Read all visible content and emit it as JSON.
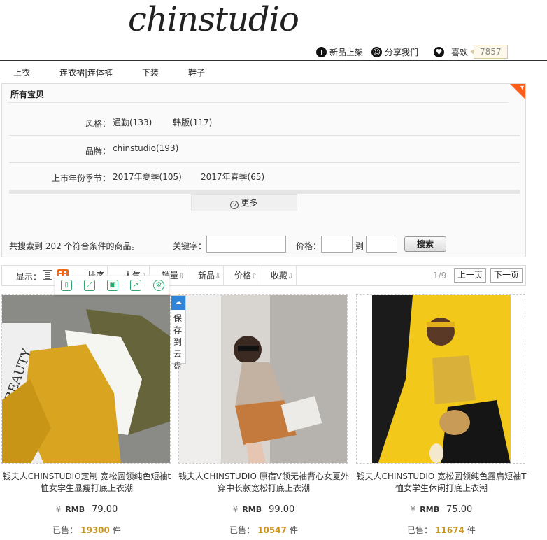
{
  "header": {
    "logo": "chinstudio",
    "links": [
      {
        "icon": "plus-circle-icon",
        "label": "新品上架"
      },
      {
        "icon": "share-circle-icon",
        "label": "分享我们"
      },
      {
        "icon": "heart-circle-icon",
        "label": "喜欢"
      }
    ],
    "like_count": "7857"
  },
  "nav": [
    "上衣",
    "连衣裙|连体裤",
    "下装",
    "鞋子"
  ],
  "filter": {
    "title": "所有宝贝",
    "rows": [
      {
        "label": "风格：",
        "options": [
          "通勤(133)",
          "韩版(117)"
        ]
      },
      {
        "label": "品牌：",
        "options": [
          "chinstudio(193)"
        ]
      },
      {
        "label": "上市年份季节：",
        "options": [
          "2017年夏季(105)",
          "2017年春季(65)"
        ]
      }
    ],
    "more_label": "更多",
    "result_text": "共搜索到 202 个符合条件的商品。",
    "keyword_label": "关键字：",
    "keyword_value": "",
    "price_label": "价格：",
    "price_to": "到",
    "price_min": "",
    "price_max": "",
    "search_button": "搜索"
  },
  "sortbar": {
    "display_label": "显示：",
    "items": [
      {
        "label": "排序",
        "arrow": ""
      },
      {
        "label": "人气",
        "arrow": "⇩"
      },
      {
        "label": "销量",
        "arrow": "⇩"
      },
      {
        "label": "新品",
        "arrow": "⇩"
      },
      {
        "label": "价格",
        "arrow": "⇧"
      },
      {
        "label": "收藏",
        "arrow": "⇩"
      }
    ],
    "page_indicator": "1/9",
    "prev": "上一页",
    "next": "下一页"
  },
  "save_to_cloud": "保存到云盘",
  "products": [
    {
      "title": "钱夫人CHINSTUDIO定制 宽松圆领纯色短袖t恤女学生显瘦打底上衣潮",
      "currency": "¥",
      "rmb": "RMB",
      "price": "79.00",
      "sold_label": "已售：",
      "sold": "19300",
      "unit": "件"
    },
    {
      "title": "钱夫人CHINSTUDIO 原宿V领无袖背心女夏外穿中长款宽松打底上衣潮",
      "currency": "¥",
      "rmb": "RMB",
      "price": "99.00",
      "sold_label": "已售：",
      "sold": "10547",
      "unit": "件"
    },
    {
      "title": "钱夫人CHINSTUDIO 宽松圆领纯色露肩短袖T恤女学生休闲打底上衣潮",
      "currency": "¥",
      "rmb": "RMB",
      "price": "75.00",
      "sold_label": "已售：",
      "sold": "11674",
      "unit": "件"
    }
  ],
  "colors": {
    "accent": "#f06a1a",
    "sold": "#c9961e",
    "tool_green": "#2aa86e",
    "cloud_blue": "#2f86d6"
  }
}
